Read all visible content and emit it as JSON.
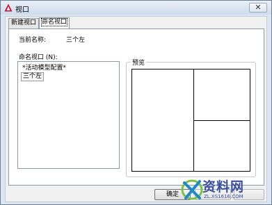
{
  "window": {
    "title": "视口"
  },
  "tabs": [
    {
      "label": "新建视口",
      "active": false
    },
    {
      "label": "命名视口",
      "active": true
    }
  ],
  "current_name": {
    "label": "当前名称:",
    "value": "三个左"
  },
  "named_viewports": {
    "label": "命名视口 (N):",
    "items": [
      "*活动模型配置*",
      "三个左"
    ],
    "selected_index": 1
  },
  "preview": {
    "label": "预览",
    "layout": "three-left"
  },
  "buttons": {
    "ok": "确定"
  },
  "watermark": {
    "brand": "资料网",
    "url": "ZL.XS1616.COM"
  }
}
